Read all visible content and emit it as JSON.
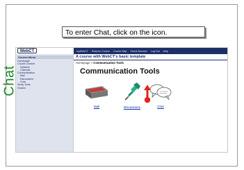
{
  "callout": {
    "text": "To enter Chat, click on the icon."
  },
  "side_label": "Chat",
  "webct": {
    "logo_text": "WebCT",
    "topnav": [
      "myWebCT",
      "Resume Course",
      "Course Map",
      "Check Browser",
      "Log Out",
      "Help"
    ],
    "course_title": "A course with WebCT's basic template",
    "breadcrumb": {
      "home": "Homepage",
      "separator": ">",
      "current": "Communication Tools"
    },
    "sidebar": {
      "title": "Course Menu",
      "items": [
        {
          "label": "Homepage",
          "sub": false
        },
        {
          "label": "Course Content",
          "sub": false
        },
        {
          "label": "Syllabus",
          "sub": true
        },
        {
          "label": "Calendar",
          "sub": true
        },
        {
          "label": "Communication",
          "sub": false
        },
        {
          "label": "Mail",
          "sub": true
        },
        {
          "label": "Discussions",
          "sub": true
        },
        {
          "label": "Chat",
          "sub": true
        },
        {
          "label": "Study Tools",
          "sub": false
        },
        {
          "label": "Grades",
          "sub": false
        }
      ]
    },
    "page_title": "Communication Tools",
    "tools": [
      {
        "label": "Mail",
        "icon": "mail-icon"
      },
      {
        "label": "Discussions",
        "icon": "pushpin-icon"
      },
      {
        "label": "Chat",
        "icon": "speech-bubbles-icon"
      }
    ]
  },
  "colors": {
    "nav_bg": "#1c2f67",
    "sidebar_bg": "#dfe3ee",
    "chat_green": "#1f8a2a",
    "arrow_red": "#e0261c"
  }
}
